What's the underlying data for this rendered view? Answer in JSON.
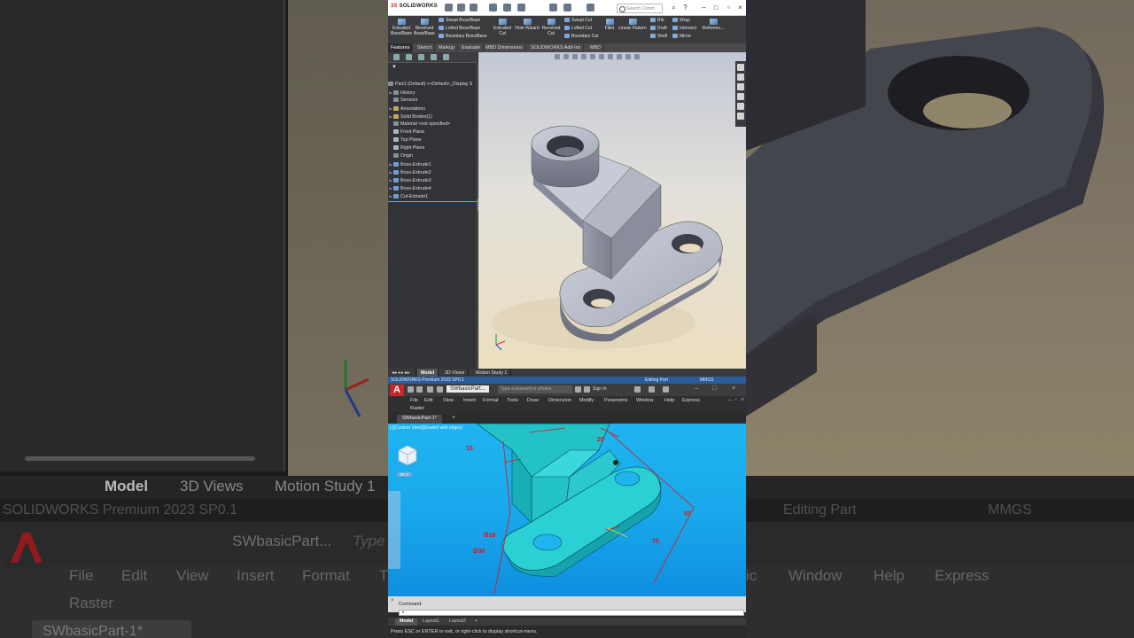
{
  "background": {
    "tabs": [
      "Model",
      "3D Views",
      "Motion Study 1"
    ],
    "status_left": "SOLIDWORKS Premium 2023 SP0.1",
    "status_mid": "Editing Part",
    "status_right": "MMGS",
    "cad_doc_name": "SWbasicPart...",
    "cad_search_placeholder": "Type",
    "menu": [
      "File",
      "Edit",
      "View",
      "Insert",
      "Format",
      "T",
      "ic",
      "Window",
      "Help",
      "Express"
    ],
    "raster": "Raster",
    "file_tab": "SWbasicPart-1*"
  },
  "solidworks": {
    "logo_prefix": "3S",
    "logo": "SOLIDWORKS",
    "search_placeholder": "Search Comm",
    "ribbon": {
      "extruded_boss": "Extruded Boss/Base",
      "revolved_boss": "Revolved Boss/Base",
      "swept_boss": "Swept Boss/Base",
      "lofted_boss": "Lofted Boss/Base",
      "boundary_boss": "Boundary Boss/Base",
      "extruded_cut": "Extruded Cut",
      "hole_wizard": "Hole Wizard",
      "revolved_cut": "Revolved Cut",
      "swept_cut": "Swept Cut",
      "lofted_cut": "Lofted Cut",
      "boundary_cut": "Boundary Cut",
      "fillet": "Fillet",
      "linear_pattern": "Linear Pattern",
      "rib": "Rib",
      "draft": "Draft",
      "shell": "Shell",
      "wrap": "Wrap",
      "intersect": "Intersect",
      "mirror": "Mirror",
      "reference": "Referenc..."
    },
    "tabs": [
      "Features",
      "Sketch",
      "Markup",
      "Evaluate",
      "MBD Dimensions",
      "SOLIDWORKS Add-Ins",
      "MBD"
    ],
    "tree": [
      "Part1 (Default) <<Default>_Display S",
      "History",
      "Sensors",
      "Annotations",
      "Solid Bodies(1)",
      "Material <not specified>",
      "Front Plane",
      "Top Plane",
      "Right Plane",
      "Origin",
      "Boss-Extrude1",
      "Boss-Extrude2",
      "Boss-Extrude3",
      "Boss-Extrude4",
      "Cut-Extrude1"
    ],
    "bottom_tabs": [
      "Model",
      "3D Views",
      "Motion Study 1"
    ],
    "status": {
      "left": "SOLIDWORKS Premium 2023 SP0.1",
      "mid": "Editing Part",
      "right": "MMGS"
    }
  },
  "autocad": {
    "logo": "A",
    "doc_name": "SWbasicPart...",
    "search_placeholder": "Type a keyword or phrase",
    "sign_in": "Sign In",
    "menu": [
      "File",
      "Edit",
      "View",
      "Insert",
      "Format",
      "Tools",
      "Draw",
      "Dimension",
      "Modify",
      "Parametric",
      "Window",
      "Help",
      "Express"
    ],
    "raster": "Raster",
    "file_tab": "SWbasicPart-1*",
    "view_label": "[-][Custom View][Shaded with edges]",
    "wcs": "WCS",
    "dims": [
      "Ø16",
      "Ø30",
      "75",
      "55",
      "15",
      "20"
    ],
    "command_label": "Command:",
    "layout_tabs": [
      "Model",
      "Layout1",
      "Layout2"
    ],
    "status": "Press ESC or ENTER to exit, or right-click to display shortcut-menu."
  },
  "colors": {
    "accent": "#1fb4f0",
    "autocad_red": "#c7262b",
    "sw_status_blue": "#2b5d9a"
  }
}
